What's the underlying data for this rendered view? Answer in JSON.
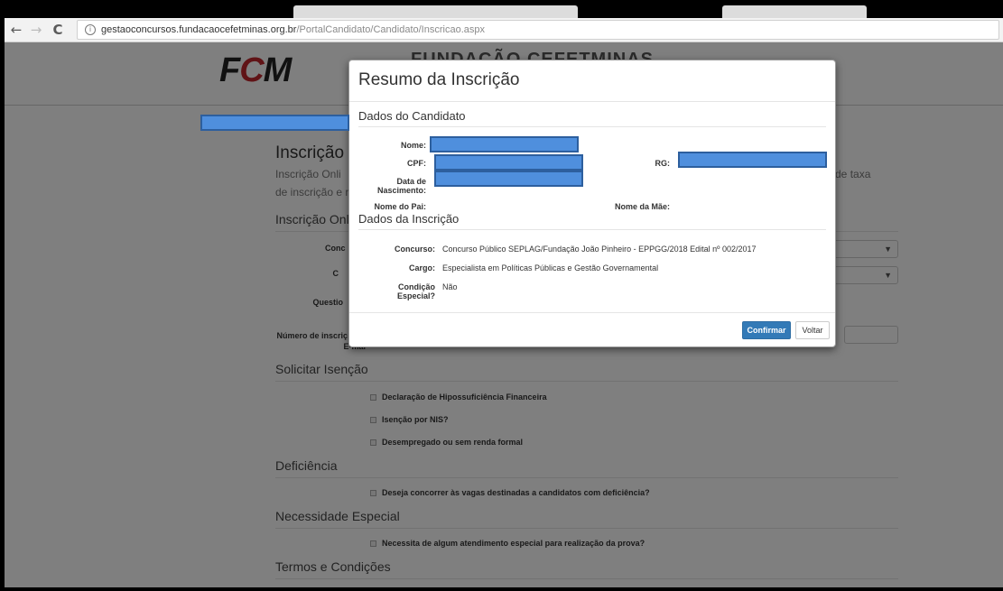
{
  "browser": {
    "back_glyph": "←",
    "forward_glyph": "→",
    "reload_glyph": "C",
    "info_glyph": "i",
    "url_host": "gestaoconcursos.fundacaocefetminas.org.br",
    "url_path": "/PortalCandidato/Candidato/Inscricao.aspx"
  },
  "site": {
    "logo_f": "F",
    "logo_c": "C",
    "logo_m": "M",
    "header_title": "FUNDAÇÃO CEFETMINAS"
  },
  "page": {
    "title": "Inscrição",
    "lead_line1": "Inscrição Onli",
    "lead_line2": "de inscrição e r",
    "lead_right": "o de taxa",
    "section_inscricao_online": "Inscrição Onli",
    "label_conc": "Conc",
    "label_c": "C",
    "label_questio": "Questio",
    "label_numero": "Número de inscriç",
    "label_email": "E-mai",
    "select_arrow": "▼",
    "section_isencao": "Solicitar Isenção",
    "isencao_options": [
      "Declaração de Hipossuficiência Financeira",
      "Isenção por NIS?",
      "Desempregado ou sem renda formal"
    ],
    "section_deficiencia": "Deficiência",
    "deficiencia_option": "Deseja concorrer às vagas destinadas a candidatos com deficiência?",
    "section_necessidade": "Necessidade Especial",
    "necessidade_option": "Necessita de algum atendimento especial para realização da prova?",
    "section_termos": "Termos e Condições"
  },
  "modal": {
    "title": "Resumo da Inscrição",
    "section_candidato": "Dados do Candidato",
    "label_nome": "Nome:",
    "label_cpf": "CPF:",
    "label_rg": "RG:",
    "label_data_nasc_1": "Data de",
    "label_data_nasc_2": "Nascimento:",
    "label_nome_pai": "Nome do Pai:",
    "label_nome_mae": "Nome da Mãe:",
    "section_inscricao": "Dados da Inscrição",
    "label_concurso": "Concurso:",
    "value_concurso": "Concurso Público SEPLAG/Fundação João Pinheiro - EPPGG/2018 Edital nº 002/2017",
    "label_cargo": "Cargo:",
    "value_cargo": "Especialista em Políticas Públicas e Gestão Governamental",
    "label_condicao_1": "Condição",
    "label_condicao_2": "Especial?",
    "value_condicao": "Não",
    "btn_confirmar": "Confirmar",
    "btn_voltar": "Voltar"
  },
  "colors": {
    "primary": "#337ab7",
    "redaction": "#4f8fdd",
    "logo_red": "#c0272d"
  }
}
